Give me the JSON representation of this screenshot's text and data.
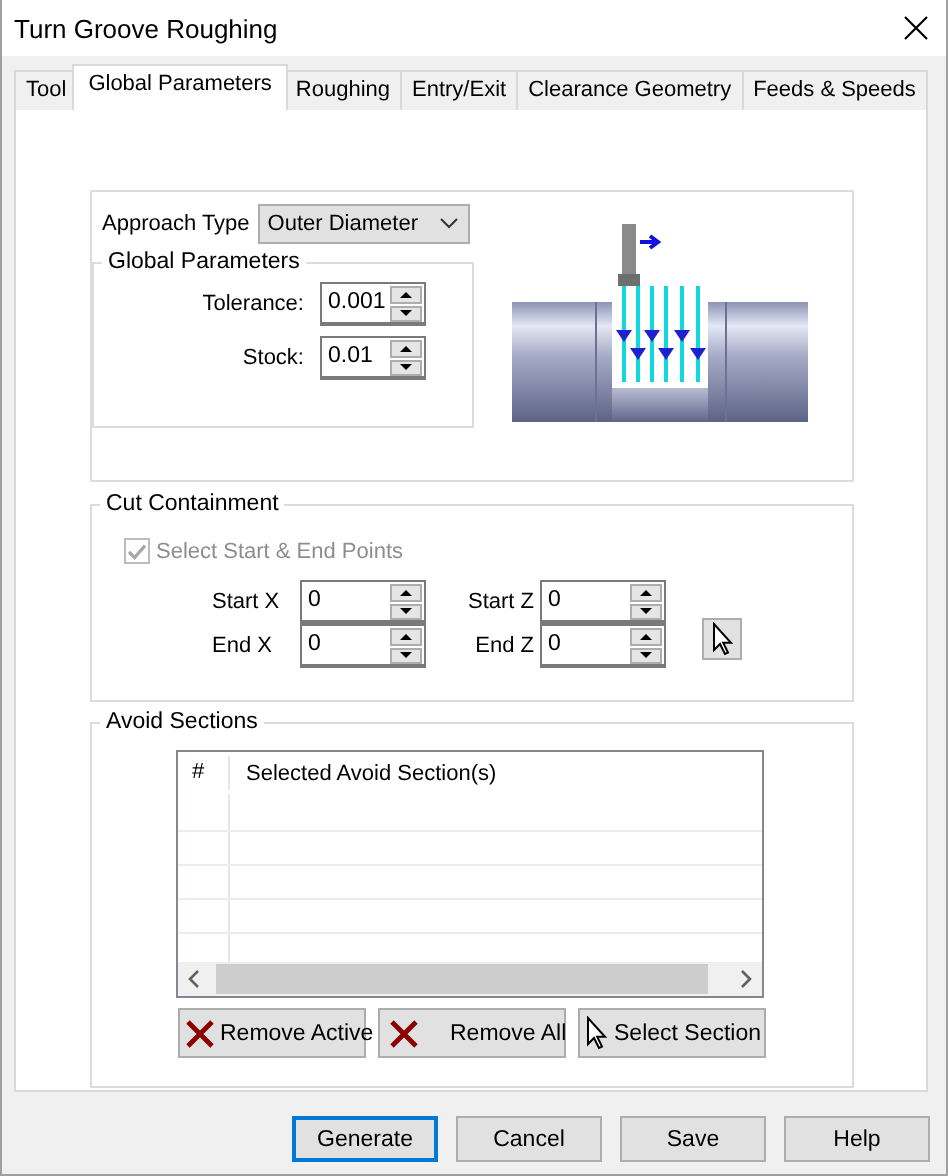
{
  "window": {
    "title": "Turn Groove Roughing"
  },
  "tabs": [
    {
      "label": "Tool",
      "selected": false
    },
    {
      "label": "Global Parameters",
      "selected": true
    },
    {
      "label": "Roughing",
      "selected": false
    },
    {
      "label": "Entry/Exit",
      "selected": false
    },
    {
      "label": "Clearance Geometry",
      "selected": false
    },
    {
      "label": "Feeds & Speeds",
      "selected": false
    }
  ],
  "global_parameters": {
    "approach_type": {
      "label": "Approach Type",
      "value": "Outer Diameter"
    },
    "title": "Global Parameters",
    "fields": [
      {
        "label": "Tolerance:",
        "value": "0.001"
      },
      {
        "label": "Stock:",
        "value": "0.01"
      }
    ]
  },
  "cut_containment": {
    "title": "Cut Containment",
    "checkbox": {
      "label": "Select Start & End Points",
      "checked": true,
      "disabled": true
    },
    "fields": [
      {
        "label": "Start X",
        "value": "0"
      },
      {
        "label": "Start Z",
        "value": "0"
      },
      {
        "label": "End X",
        "value": "0"
      },
      {
        "label": "End Z",
        "value": "0"
      }
    ]
  },
  "avoid_sections": {
    "title": "Avoid Sections",
    "table": {
      "columns": [
        "#",
        "Selected Avoid Section(s)"
      ]
    },
    "buttons": [
      {
        "label": "Remove Active",
        "kind": "remove"
      },
      {
        "label": "Remove All",
        "kind": "remove"
      },
      {
        "label": "Select Section",
        "kind": "select"
      }
    ]
  },
  "buttons": [
    {
      "label": "Generate",
      "default": true
    },
    {
      "label": "Cancel",
      "default": false
    },
    {
      "label": "Save",
      "default": false
    },
    {
      "label": "Help",
      "default": false
    }
  ]
}
